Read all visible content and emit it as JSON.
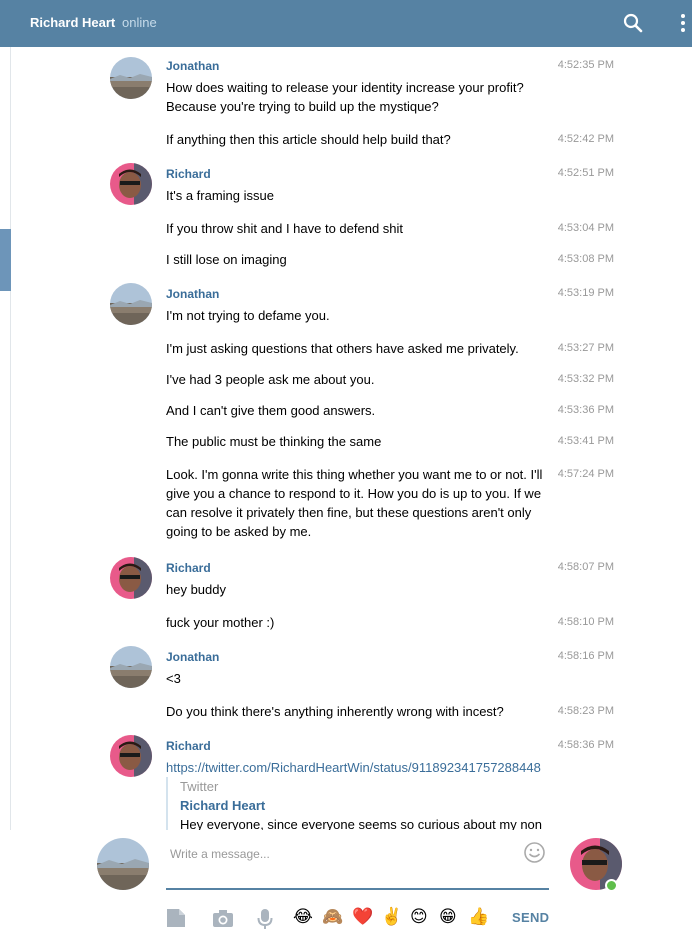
{
  "header": {
    "peer_name": "Richard Heart",
    "status": "online",
    "search_icon": "search-icon",
    "menu_icon": "more-vertical-icon",
    "accent": "#5682a3"
  },
  "messages": [
    {
      "author": "Jonathan",
      "avatar": "landscape-avatar",
      "time": "4:52:35 PM",
      "text": "How does waiting to release your identity increase your profit? Because you're trying to build up the mystique?"
    },
    {
      "author": "",
      "time": "4:52:42 PM",
      "text": "If anything then this article should help build that?"
    },
    {
      "author": "Richard",
      "avatar": "person-avatar",
      "time": "4:52:51 PM",
      "text": "It's a framing issue"
    },
    {
      "author": "",
      "time": "4:53:04 PM",
      "text": "If you throw shit and I have to defend shit"
    },
    {
      "author": "",
      "time": "4:53:08 PM",
      "text": "I still lose on imaging"
    },
    {
      "author": "Jonathan",
      "avatar": "landscape-avatar",
      "time": "4:53:19 PM",
      "text": "I'm not trying to defame you."
    },
    {
      "author": "",
      "time": "4:53:27 PM",
      "text": "I'm just asking questions that others have asked me privately."
    },
    {
      "author": "",
      "time": "4:53:32 PM",
      "text": "I've had 3 people ask me about you."
    },
    {
      "author": "",
      "time": "4:53:36 PM",
      "text": "And I can't give them good answers."
    },
    {
      "author": "",
      "time": "4:53:41 PM",
      "text": "The public must be thinking the same"
    },
    {
      "author": "",
      "time": "4:57:24 PM",
      "text": "Look. I'm gonna write this thing whether you want me to or not. I'll give you a chance to respond to it. How you do is up to you. If we can resolve it privately then fine, but these questions aren't only going to be asked by me."
    },
    {
      "author": "Richard",
      "avatar": "person-avatar",
      "time": "4:58:07 PM",
      "text": "hey buddy"
    },
    {
      "author": "",
      "time": "4:58:10 PM",
      "text": "fuck your mother :)"
    },
    {
      "author": "Jonathan",
      "avatar": "landscape-avatar",
      "time": "4:58:16 PM",
      "text": "<3"
    },
    {
      "author": "",
      "time": "4:58:23 PM",
      "text": "Do you think there's anything inherently wrong with incest?"
    },
    {
      "author": "Richard",
      "avatar": "person-avatar",
      "time": "4:58:36 PM",
      "text": "https://twitter.com/RichardHeartWin/status/911892341757288448"
    }
  ],
  "webpage": {
    "site": "Twitter",
    "title": "Richard Heart",
    "description": "Hey everyone, since everyone seems so curious about my non"
  },
  "composer": {
    "placeholder": "Write a message...",
    "send_label": "SEND",
    "tools": [
      "file-icon",
      "camera-icon",
      "microphone-icon",
      "smile-icon"
    ],
    "quick_emojis": [
      "😂",
      "🙈",
      "❤️",
      "✌️",
      "😊",
      "😁",
      "👍"
    ]
  }
}
